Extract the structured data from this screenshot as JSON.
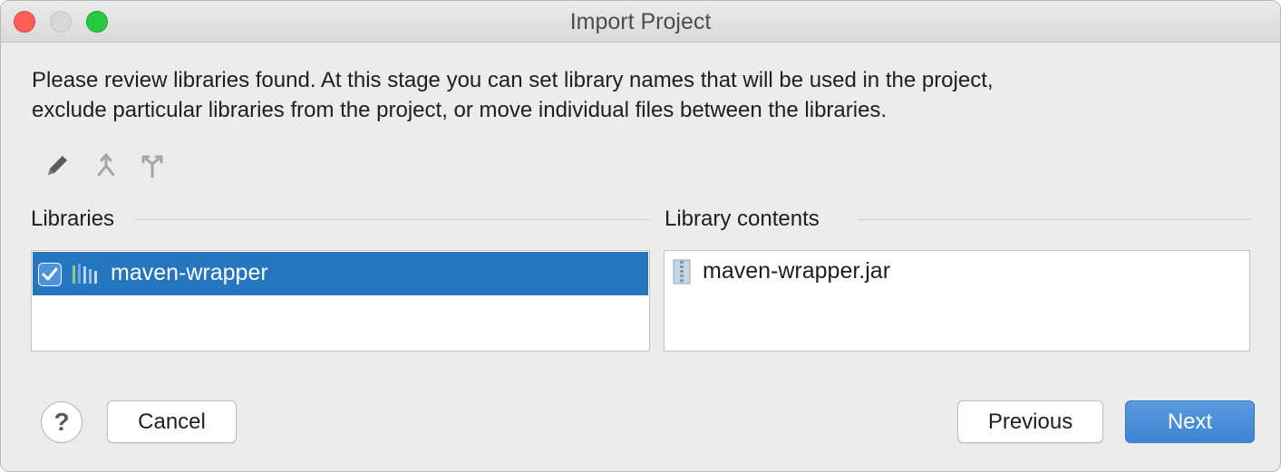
{
  "window": {
    "title": "Import Project"
  },
  "description": {
    "line1": "Please review libraries found. At this stage you can set library names that will be used in the project,",
    "line2": "exclude particular libraries from the project, or move individual files between the libraries."
  },
  "toolbar": {
    "icons": [
      "edit-pencil-icon",
      "merge-icon",
      "split-icon"
    ]
  },
  "libraries": {
    "label": "Libraries",
    "items": [
      {
        "name": "maven-wrapper",
        "checked": true,
        "selected": true
      }
    ]
  },
  "library_contents": {
    "label": "Library contents",
    "items": [
      {
        "name": "maven-wrapper.jar"
      }
    ]
  },
  "buttons": {
    "help": "?",
    "cancel": "Cancel",
    "previous": "Previous",
    "next": "Next"
  },
  "colors": {
    "selection": "#2675bf",
    "primary_button": "#3d84d3"
  }
}
